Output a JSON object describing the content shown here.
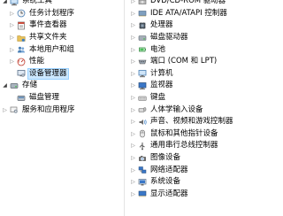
{
  "left_tree": {
    "items": [
      {
        "label": "系统工具",
        "expander": "◢",
        "icon": "computer-icon",
        "level": 0
      },
      {
        "label": "任务计划程序",
        "expander": "▷",
        "icon": "clock-icon",
        "level": 1
      },
      {
        "label": "事件查看器",
        "expander": "▷",
        "icon": "event-viewer-icon",
        "level": 1
      },
      {
        "label": "共享文件夹",
        "expander": "▷",
        "icon": "shared-folder-icon",
        "level": 1
      },
      {
        "label": "本地用户和组",
        "expander": "▷",
        "icon": "users-icon",
        "level": 1
      },
      {
        "label": "性能",
        "expander": "▷",
        "icon": "performance-icon",
        "level": 1
      },
      {
        "label": "设备管理器",
        "expander": "",
        "icon": "device-manager-icon",
        "level": 1,
        "selected": true
      },
      {
        "label": "存储",
        "expander": "◢",
        "icon": "storage-icon",
        "level": 0
      },
      {
        "label": "磁盘管理",
        "expander": "",
        "icon": "disk-management-icon",
        "level": 1
      },
      {
        "label": "服务和应用程序",
        "expander": "▷",
        "icon": "services-icon",
        "level": 0
      }
    ]
  },
  "right_tree": {
    "items": [
      {
        "label": "DVD/CD-ROM 驱动器",
        "expander": "▷",
        "icon": "dvd-drive-icon"
      },
      {
        "label": "IDE ATA/ATAPI 控制器",
        "expander": "▷",
        "icon": "ide-controller-icon"
      },
      {
        "label": "处理器",
        "expander": "▷",
        "icon": "processor-icon"
      },
      {
        "label": "磁盘驱动器",
        "expander": "▷",
        "icon": "disk-drive-icon"
      },
      {
        "label": "电池",
        "expander": "▷",
        "icon": "battery-icon"
      },
      {
        "label": "端口 (COM 和 LPT)",
        "expander": "▷",
        "icon": "port-icon"
      },
      {
        "label": "计算机",
        "expander": "▷",
        "icon": "computer-icon"
      },
      {
        "label": "监视器",
        "expander": "▷",
        "icon": "monitor-icon"
      },
      {
        "label": "键盘",
        "expander": "▷",
        "icon": "keyboard-icon"
      },
      {
        "label": "人体学输入设备",
        "expander": "▷",
        "icon": "hid-icon"
      },
      {
        "label": "声音、视频和游戏控制器",
        "expander": "▷",
        "icon": "sound-icon"
      },
      {
        "label": "鼠标和其他指针设备",
        "expander": "▷",
        "icon": "mouse-icon"
      },
      {
        "label": "通用串行总线控制器",
        "expander": "▷",
        "icon": "usb-icon"
      },
      {
        "label": "图像设备",
        "expander": "▷",
        "icon": "imaging-device-icon"
      },
      {
        "label": "网络适配器",
        "expander": "▷",
        "icon": "network-adapter-icon"
      },
      {
        "label": "系统设备",
        "expander": "▷",
        "icon": "system-device-icon"
      },
      {
        "label": "显示适配器",
        "expander": "▷",
        "icon": "display-adapter-icon"
      }
    ]
  },
  "colors": {
    "selection_bg": "#cce8ff",
    "selection_border": "#99d1ff",
    "icon_blue": "#2f6fbf",
    "icon_gray": "#6b6b6b"
  }
}
